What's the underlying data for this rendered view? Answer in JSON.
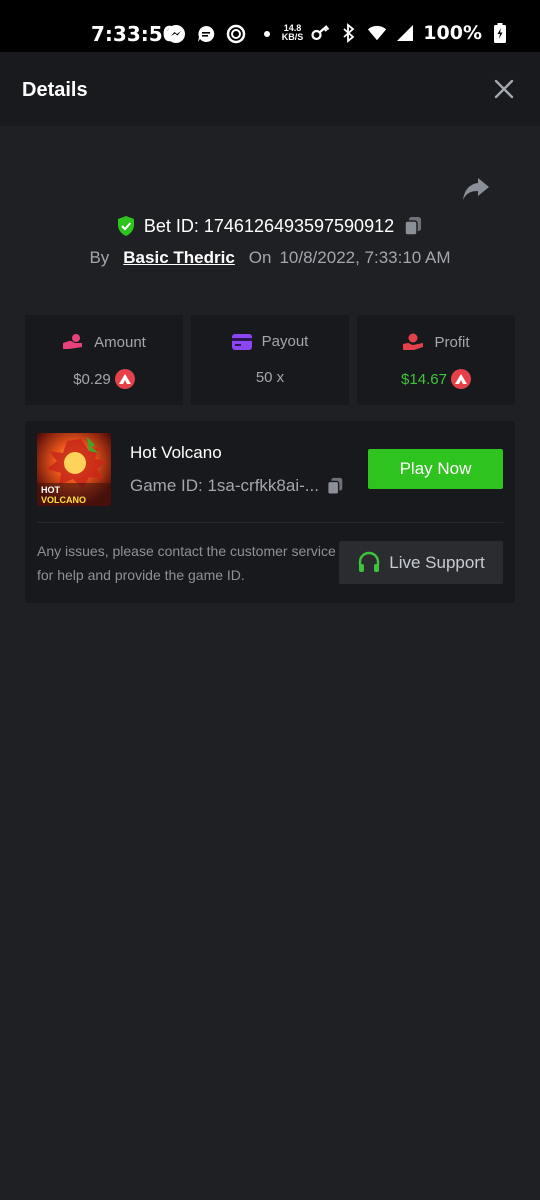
{
  "status_bar": {
    "time": "7:33:50",
    "speed_value": "14.8",
    "speed_unit": "KB/S",
    "battery": "100%"
  },
  "header": {
    "title": "Details"
  },
  "bet": {
    "id_text": "Bet ID: 1746126493597590912",
    "by_label": "By",
    "user": "Basic Thedric",
    "on_label": "On",
    "timestamp": "10/8/2022, 7:33:10 AM"
  },
  "stats": [
    {
      "label": "Amount",
      "value": "$0.29"
    },
    {
      "label": "Payout",
      "value": "50 x"
    },
    {
      "label": "Profit",
      "value": "$14.67"
    }
  ],
  "game": {
    "name": "Hot Volcano",
    "id_text": "Game ID: 1sa-crfkk8ai-...",
    "thumb_text_line1": "HOT",
    "thumb_text_line2": "VOLCANO",
    "play_label": "Play Now",
    "issues_text": "Any issues, please contact the customer service for help and provide the game ID.",
    "support_label": "Live Support"
  },
  "colors": {
    "profit": "#3ec43a",
    "play_button": "#2fc320",
    "shield": "#2fc320",
    "coin": "#e5414a"
  }
}
